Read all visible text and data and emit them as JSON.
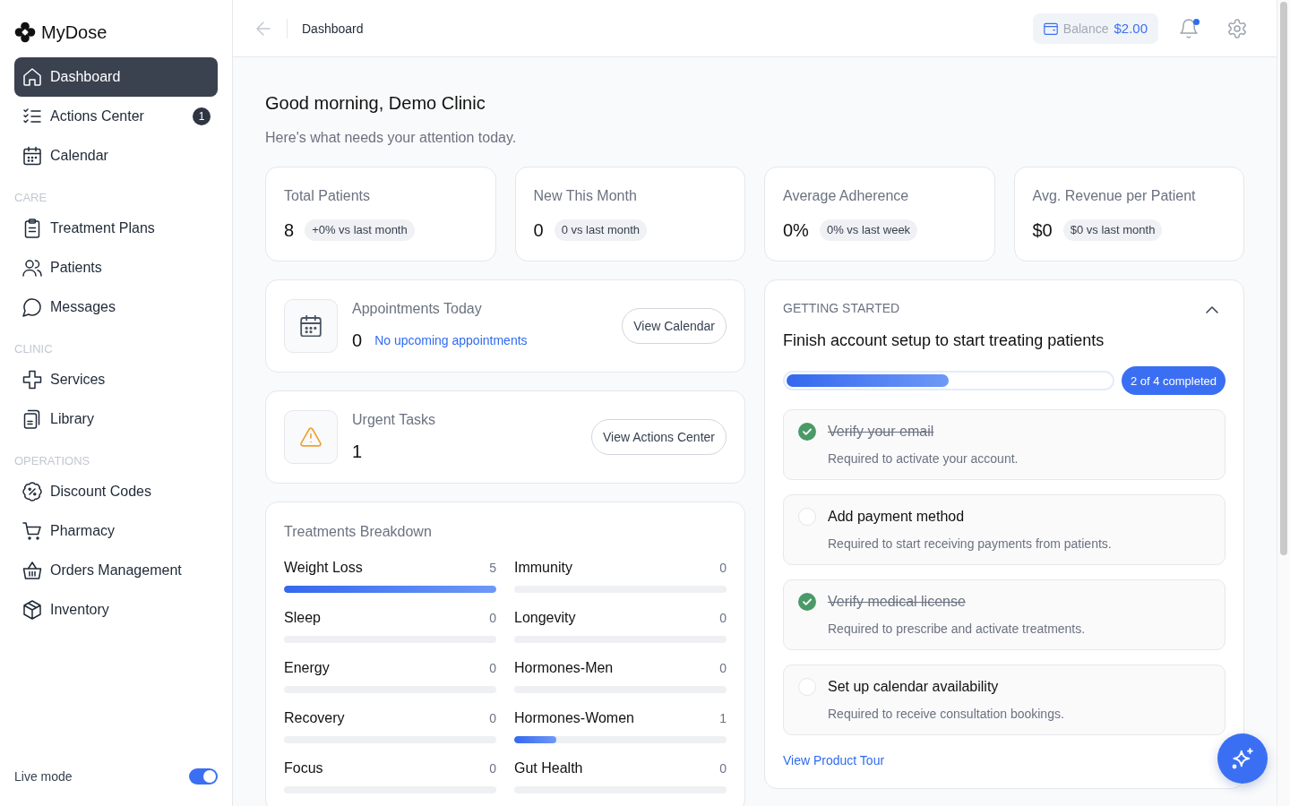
{
  "sidebar": {
    "brand": "MyDose",
    "sections": [
      {
        "items": [
          {
            "label": "Dashboard",
            "selected": true
          },
          {
            "label": "Actions Center",
            "selected": false,
            "badge": "1"
          },
          {
            "label": "Calendar",
            "selected": false
          }
        ]
      },
      {
        "heading": "CARE",
        "items": [
          {
            "label": "Treatment Plans",
            "selected": false
          },
          {
            "label": "Patients",
            "selected": false
          },
          {
            "label": "Messages",
            "selected": false
          }
        ]
      },
      {
        "heading": "CLINIC",
        "items": [
          {
            "label": "Services",
            "selected": false
          },
          {
            "label": "Library",
            "selected": false
          }
        ]
      },
      {
        "heading": "OPERATIONS",
        "items": [
          {
            "label": "Discount Codes",
            "selected": false
          },
          {
            "label": "Pharmacy",
            "selected": false
          },
          {
            "label": "Orders Management",
            "selected": false
          },
          {
            "label": "Inventory",
            "selected": false
          }
        ]
      }
    ],
    "live_mode": {
      "label": "Live mode",
      "on": true
    }
  },
  "topbar": {
    "title": "Dashboard",
    "balance": {
      "label": "Balance",
      "value": "$2.00"
    },
    "notifications": {
      "unread": true
    }
  },
  "greeting": {
    "title": "Good morning, Demo Clinic",
    "subtitle": "Here's what needs your attention today."
  },
  "stats": [
    {
      "label": "Total Patients",
      "value": "8",
      "change": "+0% vs last month"
    },
    {
      "label": "New This Month",
      "value": "0",
      "change": "0 vs last month"
    },
    {
      "label": "Average Adherence",
      "value": "0%",
      "change": "0% vs last week"
    },
    {
      "label": "Avg. Revenue per Patient",
      "value": "$0",
      "change": "$0 vs last month"
    }
  ],
  "summary_cards": [
    {
      "title": "Appointments Today",
      "value": "0",
      "note": "No upcoming appointments",
      "button": "View Calendar"
    },
    {
      "title": "Urgent Tasks",
      "value": "1",
      "button": "View Actions Center"
    }
  ],
  "treatments": {
    "title": "Treatments Breakdown",
    "items": [
      {
        "name": "Weight Loss",
        "count": "5",
        "level": 1
      },
      {
        "name": "Immunity",
        "count": "0",
        "level": 0
      },
      {
        "name": "Sleep",
        "count": "0",
        "level": 0
      },
      {
        "name": "Longevity",
        "count": "0",
        "level": 0
      },
      {
        "name": "Energy",
        "count": "0",
        "level": 0
      },
      {
        "name": "Hormones-Men",
        "count": "0",
        "level": 0
      },
      {
        "name": "Recovery",
        "count": "0",
        "level": 0
      },
      {
        "name": "Hormones-Women",
        "count": "1",
        "level": 0.2
      },
      {
        "name": "Focus",
        "count": "0",
        "level": 0
      },
      {
        "name": "Gut Health",
        "count": "0",
        "level": 0
      }
    ]
  },
  "getting_started": {
    "eyebrow": "GETTING STARTED",
    "expanded": true,
    "title": "Finish account setup to start treating patients",
    "progress": {
      "level": 0.5,
      "label": "2 of 4 completed"
    },
    "tasks": [
      {
        "title": "Verify your email",
        "description": "Required to activate your account.",
        "checked": true
      },
      {
        "title": "Add payment method",
        "description": "Required to start receiving payments from patients.",
        "checked": false
      },
      {
        "title": "Verify medical license",
        "description": "Required to prescribe and activate treatments.",
        "checked": true
      },
      {
        "title": "Set up calendar availability",
        "description": "Required to receive consultation bookings.",
        "checked": false
      }
    ],
    "link": "View Product Tour"
  }
}
